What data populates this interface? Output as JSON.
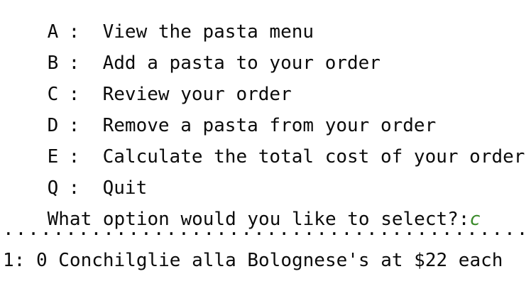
{
  "menu": {
    "items": [
      {
        "key": "A",
        "sep": ":",
        "label": "View the pasta menu"
      },
      {
        "key": "B",
        "sep": ":",
        "label": "Add a pasta to your order"
      },
      {
        "key": "C",
        "sep": ":",
        "label": "Review your order"
      },
      {
        "key": "D",
        "sep": ":",
        "label": "Remove a pasta from your order"
      },
      {
        "key": "E",
        "sep": ":",
        "label": "Calculate the total cost of your order"
      },
      {
        "key": "Q",
        "sep": ":",
        "label": "Quit"
      }
    ],
    "prompt": "What option would you like to select?:",
    "input_value": "c",
    "input_color": "#3a8a2a"
  },
  "output": {
    "divider": ".................................................",
    "order_line": "1: 0 Conchilglie alla Bolognese's at $22 each"
  }
}
